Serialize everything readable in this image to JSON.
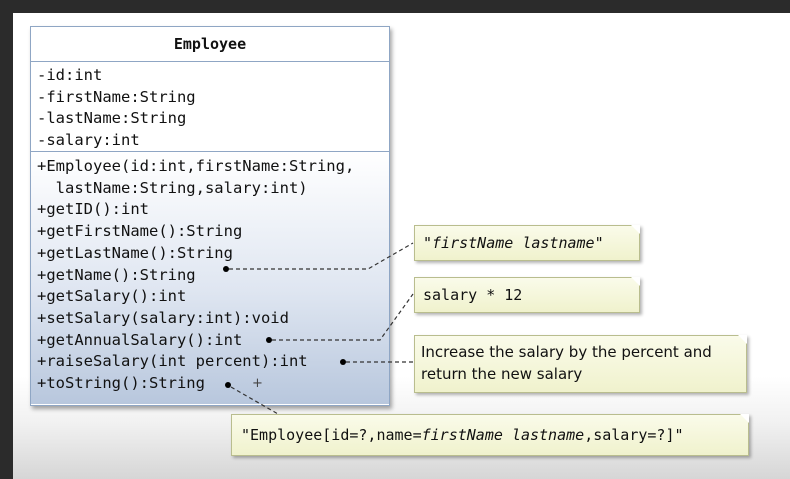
{
  "class_box": {
    "name": "Employee",
    "attributes": [
      "-id:int",
      "-firstName:String",
      "-lastName:String",
      "-salary:int"
    ],
    "methods": [
      "+Employee(id:int,firstName:String,",
      "  lastName:String,salary:int)",
      "+getID():int",
      "+getFirstName():String",
      "+getLastName():String",
      "+getName():String",
      "+getSalary():int",
      "+setSalary(salary:int):void",
      "+getAnnualSalary():int",
      "+raiseSalary(int percent):int",
      "+toString():String"
    ]
  },
  "notes": {
    "get_name": "\"firstName lastname\"",
    "annual_salary": "salary * 12",
    "raise_salary": "Increase the salary by the percent and return the new salary",
    "to_string_prefix": "\"Employee[id=?,name=",
    "to_string_italic": "firstName lastname",
    "to_string_suffix": ",salary=?]\""
  },
  "cursor_glyph": "+"
}
